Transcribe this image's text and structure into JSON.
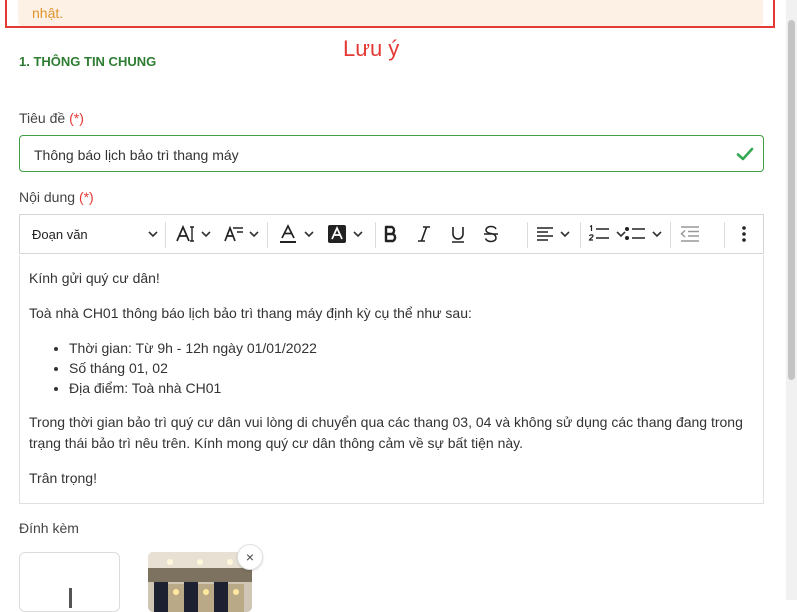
{
  "notice": {
    "text": "nhật."
  },
  "annotation": "Lưu ý",
  "section": {
    "title": "1. THÔNG TIN CHUNG"
  },
  "fields": {
    "title": {
      "label": "Tiêu đề",
      "required": "(*)",
      "value": "Thông báo lịch bảo trì thang máy"
    },
    "content": {
      "label": "Nội dung",
      "required": "(*)"
    },
    "attachment": {
      "label": "Đính kèm"
    }
  },
  "toolbar": {
    "heading_select": "Đoạn văn",
    "icons": [
      "font-size-icon",
      "line-height-icon",
      "font-color-icon",
      "highlight-icon",
      "bold-icon",
      "italic-icon",
      "underline-icon",
      "strikethrough-icon",
      "align-icon",
      "numbered-list-icon",
      "bulleted-list-icon",
      "outdent-icon",
      "more-icon"
    ]
  },
  "editor": {
    "greeting": "Kính gửi quý cư dân!",
    "intro": "Toà nhà CH01 thông báo lịch bảo trì thang máy định kỳ cụ thể như sau:",
    "bullets": [
      "Thời gian: Từ 9h - 12h ngày 01/01/2022",
      "Số tháng 01, 02",
      "Địa điểm: Toà nhà CH01"
    ],
    "body": "Trong thời gian bảo trì quý cư dân vui lòng di chuyển qua các thang 03, 04 và không sử dụng các thang đang trong trạng thái bảo trì nêu trên. Kính mong quý cư dân thông cảm về sự bất tiện này.",
    "closing": "Trân trọng!"
  },
  "attachment_close": "×",
  "colors": {
    "accent_green": "#2e7d32",
    "required_red": "#e53935",
    "notice_bg": "#fdf1e6",
    "notice_text": "#e0922f"
  }
}
